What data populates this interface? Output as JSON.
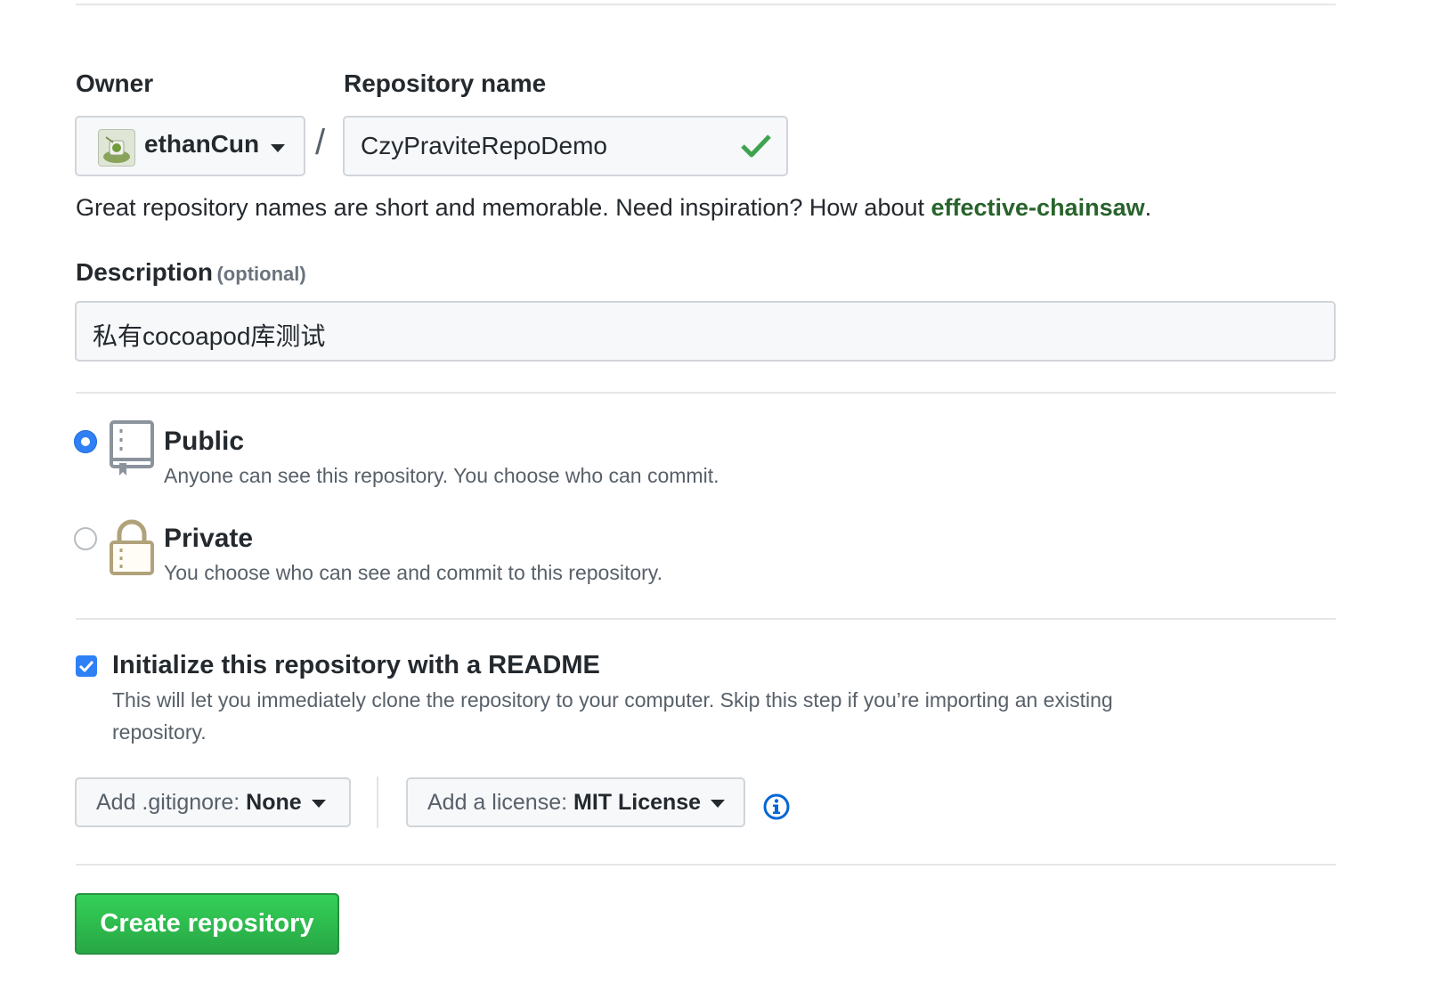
{
  "owner": {
    "label": "Owner",
    "value": "ethanCun"
  },
  "repo": {
    "label": "Repository name",
    "value": "CzyPraviteRepoDemo",
    "separator": "/"
  },
  "hint": {
    "text": "Great repository names are short and memorable. Need inspiration? How about ",
    "suggestion": "effective-chainsaw",
    "suffix": "."
  },
  "description": {
    "label": "Description",
    "optional": "(optional)",
    "value": "私有cocoapod库测试"
  },
  "visibility": {
    "public": {
      "title": "Public",
      "desc": "Anyone can see this repository. You choose who can commit.",
      "selected": true
    },
    "private": {
      "title": "Private",
      "desc": "You choose who can see and commit to this repository.",
      "selected": false
    }
  },
  "readme": {
    "title": "Initialize this repository with a README",
    "desc_line1": "This will let you immediately clone the repository to your computer. Skip this step if you’re importing an existing",
    "desc_line2": "repository.",
    "checked": true
  },
  "gitignore": {
    "key": "Add .gitignore:",
    "value": "None"
  },
  "license": {
    "key": "Add a license:",
    "value": "MIT License"
  },
  "create_button": "Create repository",
  "colors": {
    "link_green": "#28632c",
    "create_button": "#2ea44f",
    "check_green": "#3fa34d",
    "radio_blue": "#2f80f5",
    "info_blue": "#0366d6"
  }
}
